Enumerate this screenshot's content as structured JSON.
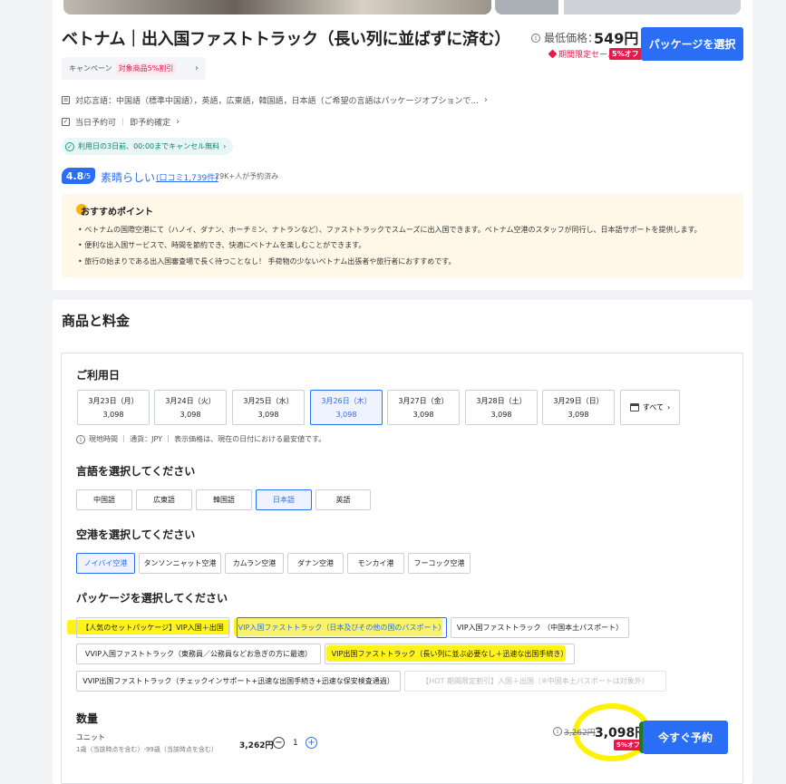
{
  "header": {
    "title": "ベトナム｜出入国ファストトラック（長い列に並ばずに済む）",
    "min_price_label": "最低価格：",
    "min_price": "549円",
    "sale_label": "期間限定セール",
    "off_badge": "5%オフ",
    "select_package_btn": "パッケージを選択"
  },
  "campaign": {
    "label": "キャンペーン",
    "value": "対象商品5%割引"
  },
  "info": {
    "languages": "対応言語：中国語（標準中国語），英語，広東語，韓国語，日本語（ご希望の言語はパッケージオプションで...",
    "same_day": "当日予約可",
    "confirm": "即予約確定",
    "cancel": "利用日の3日前、00:00までキャンセル無料"
  },
  "rating": {
    "score": "4.8",
    "max": "/5",
    "text": "素晴らしい",
    "reviews": "(口コミ1,739件)",
    "booked": "29K+人が予約済み"
  },
  "recommend": {
    "title": "おすすめポイント",
    "items": [
      "ベトナムの国際空港にて（ハノイ、ダナン、ホーチミン、ナトランなど）、ファストトラックでスムーズに出入国できます。ベトナム空港のスタッフが同行し、日本語サポートを提供します。",
      "便利な出入国サービスで、時間を節約でき、快適にベトナムを楽しむことができます。",
      "旅行の始まりである出入国審査場で長く待つことなし！ 手荷物の少ないベトナム出張者や旅行者におすすめです。"
    ]
  },
  "products": {
    "title": "商品と料金",
    "date_label": "ご利用日",
    "dates": [
      {
        "day": "3月23日（月）",
        "price": "3,098"
      },
      {
        "day": "3月24日（火）",
        "price": "3,098"
      },
      {
        "day": "3月25日（水）",
        "price": "3,098"
      },
      {
        "day": "3月26日（木）",
        "price": "3,098"
      },
      {
        "day": "3月27日（金）",
        "price": "3,098"
      },
      {
        "day": "3月28日（土）",
        "price": "3,098"
      },
      {
        "day": "3月29日（日）",
        "price": "3,098"
      }
    ],
    "all_btn": "すべて",
    "note": "現地時間 ｜ 通貨：JPY ｜ 表示価格は、現在の日付における最安値です。",
    "lang_label": "言語を選択してください",
    "languages": [
      "中国語",
      "広東語",
      "韓国語",
      "日本語",
      "英語"
    ],
    "airport_label": "空港を選択してください",
    "airports": [
      "ノイバイ空港",
      "タンソンニャット空港",
      "カムラン空港",
      "ダナン空港",
      "モンカイ港",
      "フーコック空港"
    ],
    "package_label": "パッケージを選択してください",
    "packages": [
      "【人気のセットパッケージ】VIP入国＋出国",
      "VIP入国ファストトラック（日本及びその他の国のパスポート）",
      "VIP入国ファストトラック （中国本土パスポート）",
      "VVIP入国ファストトラック（東務員／公務員などお急ぎの方に最適）",
      "VIP出国ファストトラック（長い列に並ぶ必要なし＋迅速な出国手続き）",
      "VVIP出国ファストトラック（チェックインサポート+迅速な出国手続き+迅速な保安検査通過）",
      "【HOT 期間限定割引】入国＋出国（※中国本土パスポートは対象外）"
    ],
    "qty_label": "数量",
    "unit": "ユニット",
    "unit_range": "1歳（当該時点を含む）-99歳（当該時点を含む）",
    "unit_price": "3,262円",
    "qty": "1",
    "old_price": "3,262円",
    "new_price": "3,098円",
    "off_badge": "5%オフ",
    "book_btn": "今すぐ予約"
  }
}
